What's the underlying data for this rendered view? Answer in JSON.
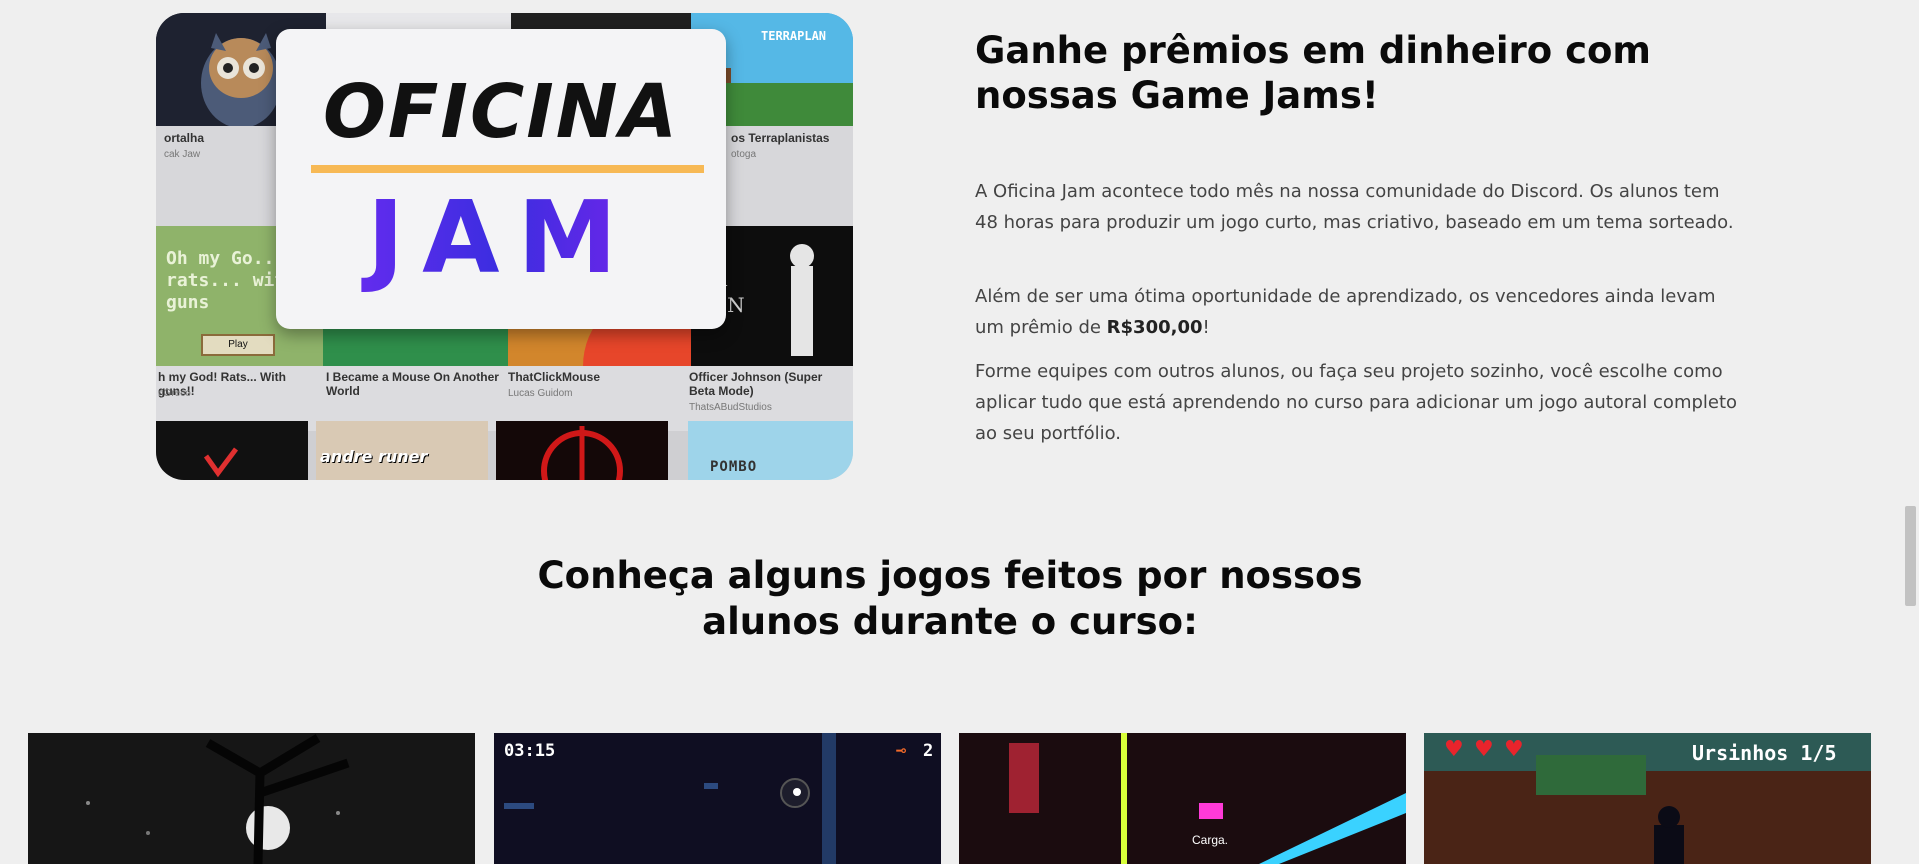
{
  "promo": {
    "logo_line1": "OFICINA",
    "logo_line2": "JAM",
    "tiles": [
      {
        "title": "ortalha",
        "author": "cak Jaw"
      },
      {
        "title": "os Terraplanistas",
        "author": "otoga"
      },
      {
        "title": "h my God! Rats... With guns!!",
        "author": "nGreco"
      },
      {
        "title": "I Became a Mouse On Another World",
        "author": ""
      },
      {
        "title": "ThatClickMouse",
        "author": "Lucas Guidom"
      },
      {
        "title": "Officer Johnson (Super Beta Mode)",
        "author": "ThatsABudStudios"
      }
    ],
    "tile_art_text": {
      "terraplan": "TERRAPLAN",
      "rats_game": "Oh my Go... rats... with guns",
      "play_btn": "Play",
      "officer_game": "ER SON",
      "runner": "andre runer",
      "pombo": "POMBO"
    }
  },
  "jam": {
    "title": "Ganhe prêmios em dinheiro com nossas Game Jams!",
    "p1": "A Oficina Jam acontece todo mês na nossa comunidade do Discord. Os alunos tem 48 horas para produzir um jogo curto, mas criativo, baseado em um tema sorteado.",
    "p2_before": "Além de ser uma ótima oportunidade de aprendizado, os vencedores ainda levam um prêmio de ",
    "p2_bold": "R$300,00",
    "p2_after": "!",
    "p3": "Forme equipes com outros alunos, ou faça seu projeto sozinho, você escolhe como aplicar tudo que está aprendendo no curso para adicionar um jogo autoral completo ao seu portfólio."
  },
  "games": {
    "heading": "Conheça alguns jogos feitos por nossos alunos durante o curso:",
    "cards": [
      {
        "label": "game-1"
      },
      {
        "label": "game-2",
        "timer": "03:15",
        "keys": "2"
      },
      {
        "label": "game-3",
        "caption": "Carga."
      },
      {
        "label": "game-4",
        "counter": "Ursinhos 1/5",
        "hearts": 3
      }
    ]
  },
  "colors": {
    "background": "#efefef",
    "logo_bar": "#f7b955",
    "logo_gradient_start": "#7a2cf6",
    "logo_gradient_end": "#3b2de0",
    "heart": "#e8242c"
  }
}
